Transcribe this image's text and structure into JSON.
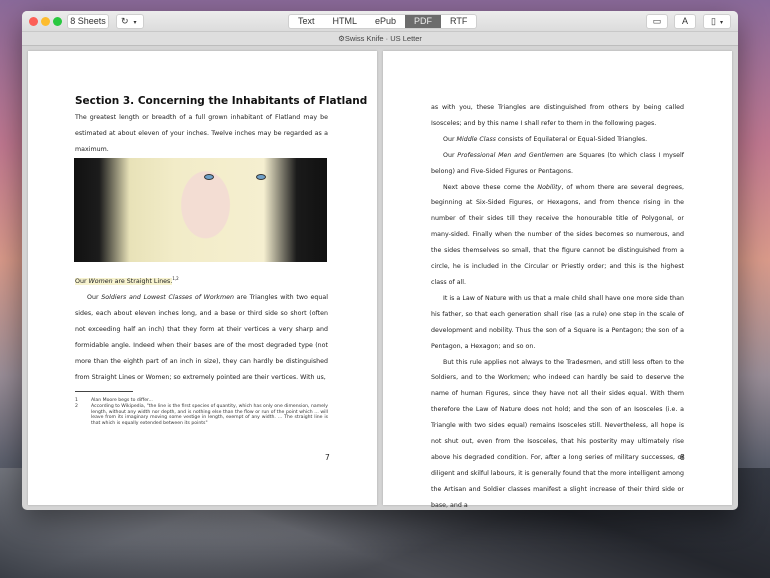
{
  "toolbar": {
    "sheets_label": "8 Sheets",
    "refresh_icon": "refresh-icon",
    "tabs": [
      "Text",
      "HTML",
      "ePub",
      "PDF",
      "RTF"
    ],
    "active_tab": "PDF",
    "subtitle": "Swiss Knife · US Letter"
  },
  "left_page": {
    "heading": "Section 3. Concerning the Inhabitants of Flatland",
    "intro": [
      [
        {
          "t": "The greatest length or breadth of a full grown inhabitant of Flatland may be estimated at about eleven of your inches. Twelve inches may be regarded as a maximum."
        }
      ]
    ],
    "highlight": {
      "pre": "Our ",
      "em": "Women",
      "post": " are Straight Lines.",
      "sup": "1,2"
    },
    "body": [
      [
        {
          "t": "Our "
        },
        {
          "t": "Soldiers and Lowest Classes of Workmen",
          "i": true
        },
        {
          "t": " are Triangles with two equal sides, each about eleven inches long, and a base or third side so short (often not exceeding half an inch) that they form at their vertices a very sharp and formidable angle. Indeed when their bases are of the most degraded type (not more than the eighth part of an inch in size), they can hardly be distinguished from Straight Lines or Women; so extremely pointed are their vertices. With us,"
        }
      ]
    ],
    "footnotes": [
      {
        "n": "1",
        "t": "Alan Moore begs to differ..."
      },
      {
        "n": "2",
        "t": "According to Wikipedia, \"the line is the first species of quantity, which has only one dimension, namely length, without any width nor depth, and is nothing else than the flow or run of the point which … will leave from its imaginary moving some vestige in length, exempt of any width. … The straight line is that which is equally extended between its points\""
      }
    ],
    "page_number": "7"
  },
  "right_page": {
    "body": [
      [
        {
          "t": "as with you, these Triangles are distinguished from others by being called Isosceles; and by this name I shall refer to them in the following pages."
        }
      ],
      [
        {
          "t": "Our "
        },
        {
          "t": "Middle Class",
          "i": true
        },
        {
          "t": " consists of Equilateral or Equal-Sided Triangles."
        }
      ],
      [
        {
          "t": "Our "
        },
        {
          "t": "Professional Men and Gentlemen",
          "i": true
        },
        {
          "t": " are Squares (to which class I myself belong) and Five-Sided Figures or Pentagons."
        }
      ],
      [
        {
          "t": "Next above these come the "
        },
        {
          "t": "Nobility",
          "i": true
        },
        {
          "t": ", of whom there are several degrees, beginning at Six-Sided Figures, or Hexagons, and from thence rising in the number of their sides till they receive the honourable title of Polygonal, or many-sided. Finally when the number of the sides becomes so numerous, and the sides themselves so small, that the figure cannot be distinguished from a circle, he is included in the Circular or Priestly order; and this is the highest class of all."
        }
      ],
      [
        {
          "t": "It is a Law of Nature with us that a male child shall have one more side than his father, so that each generation shall rise (as a rule) one step in the scale of development and nobility. Thus the son of a Square is a Pentagon; the son of a Pentagon, a Hexagon; and so on."
        }
      ],
      [
        {
          "t": "But this rule applies not always to the Tradesmen, and still less often to the Soldiers, and to the Workmen; who indeed can hardly be said to deserve the name of human Figures, since they have not all their sides equal. With them therefore the Law of Nature does not hold; and the son of an Isosceles (i.e. a Triangle with two sides equal) remains Isosceles still. Nevertheless, all hope is not shut out, even from the Isosceles, that his posterity may ultimately rise above his degraded condition. For, after a long series of military successes, or diligent and skilful labours, it is generally found that the more intelligent among the Artisan and Soldier classes manifest a slight increase of their third side or base, and a"
        }
      ]
    ],
    "page_number": "8"
  }
}
